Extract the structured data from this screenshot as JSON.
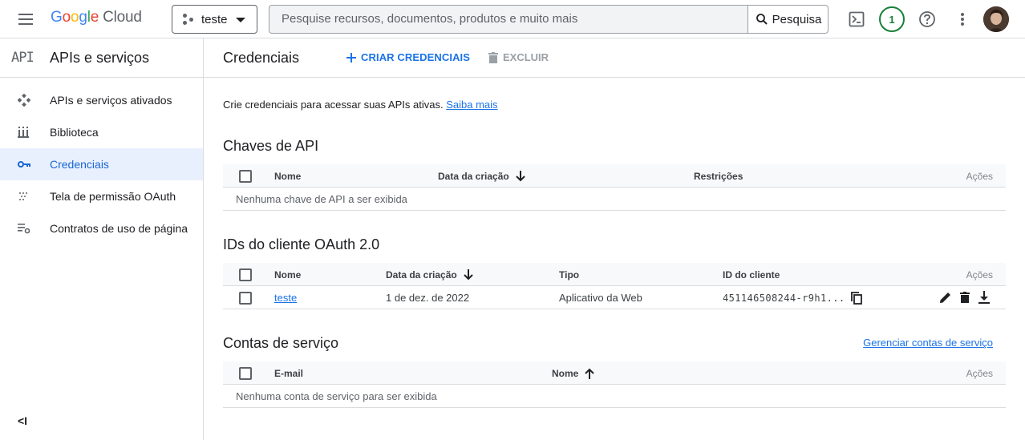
{
  "topbar": {
    "logo_google": [
      "G",
      "o",
      "o",
      "g",
      "l",
      "e"
    ],
    "logo_cloud": "Cloud",
    "project": "teste",
    "search_placeholder": "Pesquise recursos, documentos, produtos e muito mais",
    "search_button": "Pesquisa",
    "notifications_count": "1"
  },
  "sidebar": {
    "api_mark": "API",
    "title": "APIs e serviços",
    "items": [
      {
        "label": "APIs e serviços ativados",
        "icon": "diamond-grid-icon"
      },
      {
        "label": "Biblioteca",
        "icon": "library-icon"
      },
      {
        "label": "Credenciais",
        "icon": "key-icon",
        "active": true
      },
      {
        "label": "Tela de permissão OAuth",
        "icon": "dots-grid-icon"
      },
      {
        "label": "Contratos de uso de página",
        "icon": "settings-list-icon"
      }
    ],
    "collapse_glyph": "<I"
  },
  "main": {
    "title": "Credenciais",
    "create_label": "CRIAR CREDENCIAIS",
    "delete_label": "EXCLUIR",
    "intro_text": "Crie credenciais para acessar suas APIs ativas.",
    "intro_link": "Saiba mais",
    "api_keys": {
      "title": "Chaves de API",
      "columns": [
        "Nome",
        "Data da criação",
        "Restrições",
        "Ações"
      ],
      "empty": "Nenhuma chave de API a ser exibida"
    },
    "oauth": {
      "title": "IDs do cliente OAuth 2.0",
      "columns": [
        "Nome",
        "Data da criação",
        "Tipo",
        "ID do cliente",
        "Ações"
      ],
      "rows": [
        {
          "name": "teste",
          "date": "1 de dez. de 2022",
          "type": "Aplicativo da Web",
          "client_id": "451146508244-r9h1..."
        }
      ]
    },
    "service_accounts": {
      "title": "Contas de serviço",
      "manage_link": "Gerenciar contas de serviço",
      "columns": [
        "E-mail",
        "Nome",
        "Ações"
      ],
      "empty": "Nenhuma conta de serviço para ser exibida"
    }
  },
  "colors": {
    "accent": "#1a73e8",
    "active_bg": "#e8f0fe",
    "badge": "#188038"
  }
}
